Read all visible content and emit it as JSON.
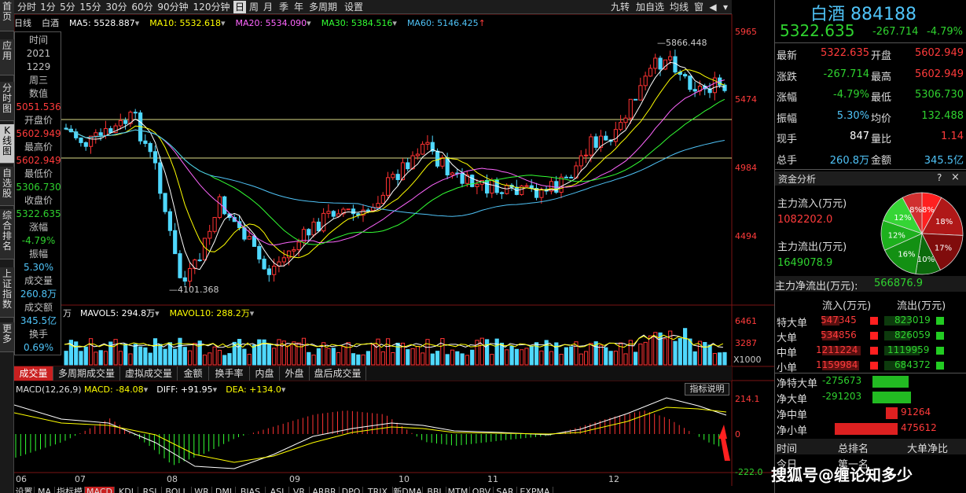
{
  "left_nav": [
    {
      "label": "首页"
    },
    {
      "label": "应用"
    },
    {
      "label": "分时图"
    },
    {
      "label": "K线图"
    },
    {
      "label": "自选股"
    },
    {
      "label": "综合排名"
    },
    {
      "label": "上证指数"
    },
    {
      "label": "更多"
    }
  ],
  "toolbar": {
    "periods": [
      "分时",
      "1分",
      "5分",
      "15分",
      "30分",
      "60分",
      "90分钟",
      "120分钟",
      "日",
      "周",
      "月",
      "季",
      "年",
      "多周期",
      "设置"
    ],
    "active_period": "日",
    "right_buttons": [
      "九转",
      "加自选",
      "均线",
      "窗"
    ]
  },
  "main_chart": {
    "type_label": "日线",
    "name": "白酒",
    "ma": [
      {
        "label": "MA5: 5528.887",
        "color": "#ffffff"
      },
      {
        "label": "MA10: 5532.618",
        "color": "#ffff00"
      },
      {
        "label": "MA20: 5534.090",
        "color": "#ff66ff"
      },
      {
        "label": "MA30: 5384.516",
        "color": "#33ff33"
      },
      {
        "label": "MA60: 5146.425",
        "color": "#4fc3f7"
      }
    ],
    "price_ticks": [
      "5965",
      "5474",
      "4984",
      "4494"
    ],
    "high_annotation": "5866.448",
    "low_annotation": "4101.368"
  },
  "infobox": {
    "time_label": "时间",
    "year": "2021",
    "date": "1229",
    "weekday": "周三",
    "value_label": "数值",
    "value": "5051.536",
    "open_label": "开盘价",
    "open": "5602.949",
    "high_label": "最高价",
    "high": "5602.949",
    "low_label": "最低价",
    "low": "5306.730",
    "close_label": "收盘价",
    "close": "5322.635",
    "change_label": "涨幅",
    "change": "-4.79%",
    "amp_label": "振幅",
    "amp": "5.30%",
    "vol_label": "成交量",
    "vol": "260.8万",
    "amount_label": "成交额",
    "amount": "345.5亿",
    "turnover_label": "换手",
    "turnover": "0.69%"
  },
  "volume_panel": {
    "unit": "万",
    "mavol5": "MAVOL5: 294.8万",
    "mavol10": "MAVOL10: 288.2万",
    "ticks": [
      "6461",
      "3287"
    ],
    "multiplier": "X1000"
  },
  "sub_tabs": [
    "成交量",
    "多周期成交量",
    "虚拟成交量",
    "金额",
    "换手率",
    "内盘",
    "外盘",
    "盘后成交量"
  ],
  "active_sub_tab": "成交量",
  "macd_panel": {
    "params": "MACD(12,26,9)",
    "macd": "MACD: -84.08",
    "diff": "DIFF: +91.95",
    "dea": "DEA: +134.0",
    "help_button": "指标说明",
    "ticks": [
      "214.1",
      "0",
      "-222.0"
    ]
  },
  "x_axis_months": [
    "06",
    "07",
    "08",
    "09",
    "10",
    "11",
    "12"
  ],
  "index_tabs": [
    "设置",
    "MA",
    "指标模板",
    "MACD",
    "KDJ",
    "RSI",
    "BOLL",
    "WR",
    "DMI",
    "BIAS",
    "ASI",
    "VR",
    "ARBR",
    "DPO",
    "TRIX",
    "新DMA",
    "BBI",
    "MTM",
    "OBV",
    "SAR",
    "EXPMA"
  ],
  "right_panel": {
    "title": "白酒",
    "code": "884188",
    "price": "5322.635",
    "change": "-267.714",
    "change_pct": "-4.79%",
    "quote_rows": [
      {
        "l1": "最新",
        "v1": "5322.635",
        "c1": "#ff3b3b",
        "l2": "开盘",
        "v2": "5602.949",
        "c2": "#ff3b3b"
      },
      {
        "l1": "涨跌",
        "v1": "-267.714",
        "c1": "#2fd22f",
        "l2": "最高",
        "v2": "5602.949",
        "c2": "#ff3b3b"
      },
      {
        "l1": "涨幅",
        "v1": "-4.79%",
        "c1": "#2fd22f",
        "l2": "最低",
        "v2": "5306.730",
        "c2": "#2fd22f"
      },
      {
        "l1": "振幅",
        "v1": "5.30%",
        "c1": "#4fc3f7",
        "l2": "均价",
        "v2": "132.488",
        "c2": "#2fd22f"
      },
      {
        "l1": "现手",
        "v1": "847",
        "c1": "#ffffff",
        "l2": "量比",
        "v2": "1.14",
        "c2": "#ff3b3b"
      },
      {
        "l1": "总手",
        "v1": "260.8万",
        "c1": "#4fc3f7",
        "l2": "金额",
        "v2": "345.5亿",
        "c2": "#4fc3f7"
      }
    ],
    "fund_title": "资金分析",
    "fund_help": "?",
    "fund_close": "×",
    "inflow_label": "主力流入(万元)",
    "inflow_value": "1082202.0",
    "outflow_label": "主力流出(万元)",
    "outflow_value": "1649078.9",
    "net_label": "主力净流出(万元):",
    "net_value": "566876.9",
    "pie": [
      {
        "label": "8%",
        "value": 8,
        "color": "#ff2020"
      },
      {
        "label": "18%",
        "value": 18,
        "color": "#b01818"
      },
      {
        "label": "17%",
        "value": 17,
        "color": "#800c0c"
      },
      {
        "label": "10%",
        "value": 10,
        "color": "#0c6a0c"
      },
      {
        "label": "16%",
        "value": 16,
        "color": "#139013"
      },
      {
        "label": "12%",
        "value": 12,
        "color": "#1db01d"
      },
      {
        "label": "12%",
        "value": 12,
        "color": "#35d535"
      },
      {
        "label": "8%",
        "value": 8,
        "color": "#d03030"
      }
    ],
    "flow_headers": [
      "流入(万元)",
      "流出(万元)"
    ],
    "flow_rows": [
      {
        "label": "特大单",
        "in": "547345",
        "out": "823019",
        "in_frac": 0.3,
        "out_frac": 0.45
      },
      {
        "label": "大单",
        "in": "534856",
        "out": "826059",
        "in_frac": 0.29,
        "out_frac": 0.45
      },
      {
        "label": "中单",
        "in": "1211224",
        "out": "1119959",
        "in_frac": 0.66,
        "out_frac": 0.61
      },
      {
        "label": "小单",
        "in": "1159984",
        "out": "684372",
        "in_frac": 0.63,
        "out_frac": 0.37
      }
    ],
    "net_rows": [
      {
        "label": "净特大单",
        "value": "-275673",
        "frac": 0.58,
        "color": "#22bb22"
      },
      {
        "label": "净大单",
        "value": "-291203",
        "frac": 0.61,
        "color": "#22bb22"
      },
      {
        "label": "净中单",
        "value": "91264",
        "frac": 0.19,
        "color": "#dd2020"
      },
      {
        "label": "净小单",
        "value": "475612",
        "frac": 1.0,
        "color": "#dd2020"
      }
    ],
    "bottom_headers": [
      "时间",
      "总排名",
      "大单净比"
    ],
    "bottom_row": [
      "今日",
      "第一名",
      ""
    ]
  },
  "watermark": "搜狐号@缠论知多少"
}
